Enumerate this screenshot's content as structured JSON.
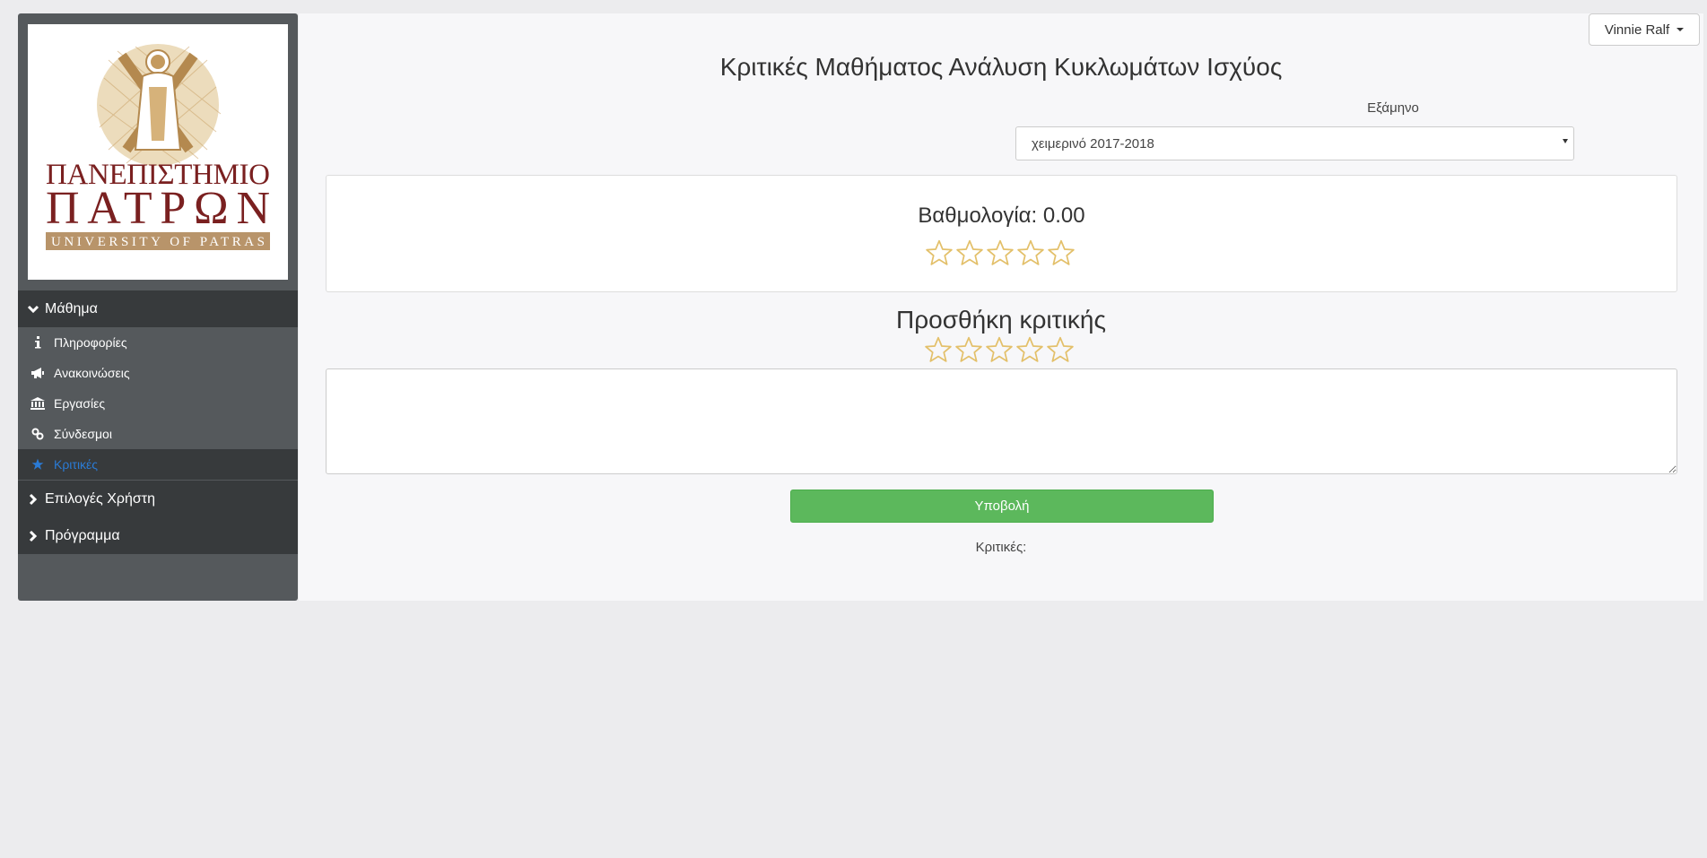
{
  "header": {
    "user_name": "Vinnie Ralf"
  },
  "logo": {
    "line1": "ΠΑΝΕΠΙΣΤΗΜΙΟ",
    "line2": "ΠΑΤΡΩΝ",
    "line3": "UNIVERSITY OF PATRAS"
  },
  "sidebar": {
    "sections": [
      {
        "label": "Μάθημα",
        "expanded": true
      },
      {
        "label": "Επιλογές Χρήστη",
        "expanded": false
      },
      {
        "label": "Πρόγραμμα",
        "expanded": false
      }
    ],
    "items": [
      {
        "label": "Πληροφορίες",
        "icon": "info-icon"
      },
      {
        "label": "Ανακοινώσεις",
        "icon": "bullhorn-icon"
      },
      {
        "label": "Εργασίες",
        "icon": "institution-icon"
      },
      {
        "label": "Σύνδεσμοι",
        "icon": "link-icon"
      },
      {
        "label": "Κριτικές",
        "icon": "star-icon",
        "active": true
      }
    ]
  },
  "main": {
    "title": "Κριτικές Μαθήματος Ανάλυση Κυκλωμάτων Ισχύος",
    "semester_label": "Εξάμηνο",
    "semester_value": "χειμερινό 2017-2018",
    "rating_text": "Βαθμολογία: 0.00",
    "rating_value": 0,
    "rating_max": 5,
    "add_review_title": "Προσθήκη κριτικής",
    "new_rating_value": 0,
    "review_text_value": "",
    "submit_label": "Υποβολή",
    "reviews_label": "Κριτικές:"
  },
  "colors": {
    "sidebar_bg": "#55595c",
    "sidebar_dark": "#373a3c",
    "active_link": "#2a7bd6",
    "submit_green": "#5cb85c",
    "star_outline": "#e3c06a",
    "logo_red": "#7a2020",
    "logo_gold": "#b8946a"
  }
}
